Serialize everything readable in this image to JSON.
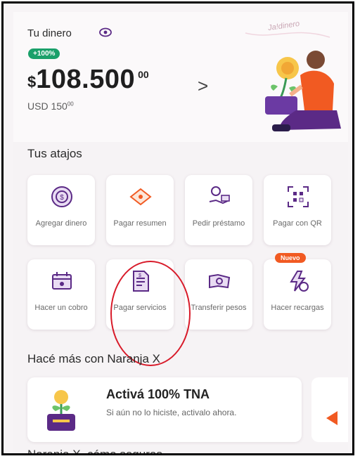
{
  "balance": {
    "label": "Tu dinero",
    "badge": "+100%",
    "currency": "$",
    "amount": "108.500",
    "cents": "00",
    "usd_label": "USD 150",
    "usd_cents": "00",
    "illustration_text": "Ja!dinero"
  },
  "shortcuts": {
    "title": "Tus atajos",
    "new_tag": "Nuevo",
    "items": [
      {
        "label": "Agregar dinero"
      },
      {
        "label": "Pagar resumen"
      },
      {
        "label": "Pedir préstamo"
      },
      {
        "label": "Pagar con QR"
      },
      {
        "label": "Hacer un cobro"
      },
      {
        "label": "Pagar servicios"
      },
      {
        "label": "Transferir pesos"
      },
      {
        "label": "Hacer recargas"
      }
    ]
  },
  "more": {
    "title": "Hacé más con Naranja X",
    "promo_title": "Activá 100% TNA",
    "promo_text": "Si aún no lo hiciste, activalo ahora."
  },
  "footer_cut_text": "Naranja X, cómo seguros",
  "colors": {
    "accent_purple": "#5b2a86",
    "brand_orange": "#f15a22",
    "badge_green": "#1aa06a",
    "highlight_red": "#d81b2a"
  },
  "icons": [
    "eye-icon",
    "coin-icon",
    "card-tag-icon",
    "hand-money-icon",
    "qr-icon",
    "calendar-cash-icon",
    "invoice-icon",
    "transfer-icon",
    "bolt-phone-icon",
    "plant-coin-icon"
  ]
}
